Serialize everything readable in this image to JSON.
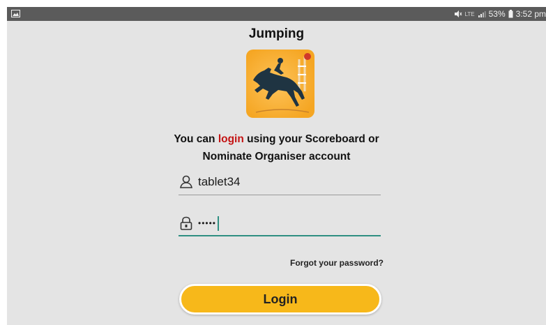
{
  "status_bar": {
    "battery": "53%",
    "time": "3:52 pm",
    "network": "LTE"
  },
  "app": {
    "title": "Jumping",
    "logo_icon": "horse-jumping-icon"
  },
  "login": {
    "message_before": "You can ",
    "message_highlight": "login",
    "message_after": " using your Scoreboard or",
    "message_line2": "Nominate Organiser account",
    "username_value": "tablet34",
    "password_masked": "•••••",
    "forgot_label": "Forgot your password?",
    "button_label": "Login"
  },
  "colors": {
    "accent": "#f7b81a",
    "highlight": "#c41414",
    "focus_line": "#2f8f82"
  }
}
